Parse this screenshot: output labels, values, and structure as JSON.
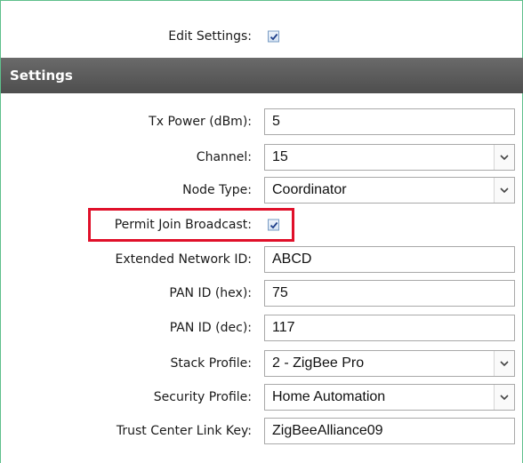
{
  "edit_settings": {
    "label": "Edit Settings:",
    "checked": true
  },
  "section_title": "Settings",
  "fields": [
    {
      "label": "Tx Power (dBm):",
      "value": "5",
      "type": "text"
    },
    {
      "label": "Channel:",
      "value": "15",
      "type": "select"
    },
    {
      "label": "Node Type:",
      "value": "Coordinator",
      "type": "select"
    },
    {
      "label": "Permit Join Broadcast:",
      "checked": true,
      "type": "checkbox"
    },
    {
      "label": "Extended Network ID:",
      "value": "ABCD",
      "type": "text"
    },
    {
      "label": "PAN ID (hex):",
      "value": "75",
      "type": "text"
    },
    {
      "label": "PAN ID (dec):",
      "value": "117",
      "type": "text"
    },
    {
      "label": "Stack Profile:",
      "value": "2 - ZigBee Pro",
      "type": "select"
    },
    {
      "label": "Security Profile:",
      "value": "Home Automation",
      "type": "select"
    },
    {
      "label": "Trust Center Link Key:",
      "value": "ZigBeeAlliance09",
      "type": "text"
    }
  ],
  "colors": {
    "highlight": "#e0102a",
    "header_bg": "#5a5a5a",
    "frame_border": "#5fbf8c"
  },
  "icons": {
    "checkbox": "checkmark-icon",
    "dropdown": "chevron-down-icon"
  }
}
